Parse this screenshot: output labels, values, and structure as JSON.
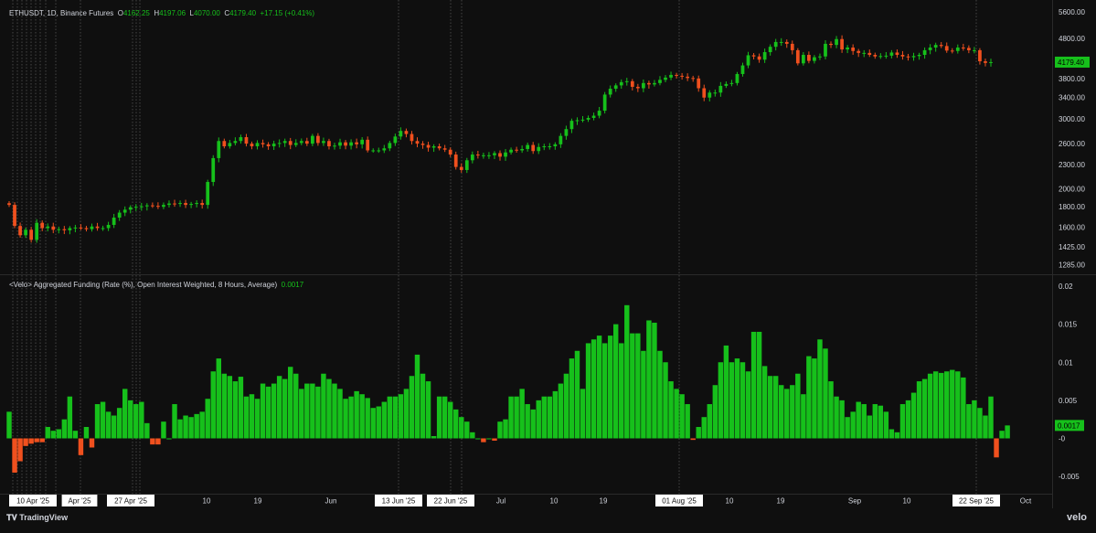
{
  "header": {
    "symbol_line": "ETHUSDT, 1D, Binance Futures",
    "o_key": "O",
    "o_val": "4162.25",
    "h_key": "H",
    "h_val": "4197.06",
    "l_key": "L",
    "l_val": "4070.00",
    "c_key": "C",
    "c_val": "4179.40",
    "chg": "+17.15 (+0.41%)"
  },
  "indicator": {
    "title": "<Velo> Aggregated Funding (Rate (%), Open Interest Weighted, 8 Hours, Average)",
    "value": "0.0017"
  },
  "branding": {
    "tradingview": "TradingView",
    "velo": "velo"
  },
  "colors": {
    "up": "#16c01b",
    "down": "#f0501e",
    "bg": "#0f0f0f",
    "grid": "#2a2a2a",
    "text": "#d1d4dc"
  },
  "chart_data": [
    {
      "type": "candlestick",
      "y_axis_scale": "log",
      "price_ticks": [
        "5600.00",
        "4800.00",
        "4200.00",
        "3800.00",
        "3400.00",
        "3000.00",
        "2600.00",
        "2300.00",
        "2000.00",
        "1800.00",
        "1600.00",
        "1425.00",
        "1285.00"
      ],
      "last_price_label": "4179.40",
      "closes": [
        1820,
        1610,
        1525,
        1575,
        1485,
        1640,
        1590,
        1605,
        1575,
        1580,
        1570,
        1590,
        1595,
        1590,
        1580,
        1605,
        1590,
        1590,
        1620,
        1690,
        1740,
        1770,
        1795,
        1800,
        1805,
        1815,
        1810,
        1800,
        1820,
        1835,
        1830,
        1840,
        1820,
        1830,
        1840,
        1820,
        2080,
        2390,
        2640,
        2560,
        2610,
        2640,
        2700,
        2600,
        2560,
        2610,
        2590,
        2560,
        2600,
        2610,
        2640,
        2580,
        2610,
        2640,
        2600,
        2720,
        2610,
        2640,
        2560,
        2570,
        2620,
        2570,
        2620,
        2590,
        2660,
        2500,
        2500,
        2500,
        2530,
        2610,
        2710,
        2800,
        2750,
        2640,
        2600,
        2580,
        2540,
        2560,
        2530,
        2510,
        2440,
        2270,
        2230,
        2360,
        2440,
        2430,
        2430,
        2430,
        2460,
        2410,
        2470,
        2510,
        2500,
        2520,
        2580,
        2490,
        2550,
        2560,
        2560,
        2590,
        2720,
        2830,
        2970,
        2980,
        2990,
        3020,
        3060,
        3150,
        3460,
        3580,
        3650,
        3720,
        3740,
        3620,
        3590,
        3700,
        3670,
        3700,
        3770,
        3820,
        3880,
        3860,
        3840,
        3810,
        3800,
        3590,
        3400,
        3500,
        3500,
        3640,
        3680,
        3700,
        3900,
        4100,
        4350,
        4320,
        4240,
        4430,
        4570,
        4700,
        4700,
        4650,
        4480,
        4150,
        4360,
        4210,
        4300,
        4320,
        4650,
        4620,
        4780,
        4500,
        4550,
        4460,
        4410,
        4410,
        4360,
        4320,
        4330,
        4340,
        4420,
        4360,
        4320,
        4300,
        4330,
        4360,
        4480,
        4550,
        4620,
        4590,
        4470,
        4460,
        4550,
        4540,
        4480,
        4480,
        4200,
        4160,
        4180
      ],
      "funding_values": [
        0.0035,
        -0.0045,
        -0.003,
        -0.001,
        -0.0007,
        -0.0005,
        -0.0005,
        0.0015,
        0.001,
        0.0012,
        0.0025,
        0.0055,
        0.001,
        -0.0022,
        0.0015,
        -0.0012,
        0.0045,
        0.0048,
        0.0035,
        0.003,
        0.004,
        0.0065,
        0.005,
        0.0045,
        0.0048,
        0.002,
        -0.0008,
        -0.0008,
        0.0022,
        0.0,
        0.0045,
        0.0025,
        0.003,
        0.0028,
        0.0032,
        0.0035,
        0.0052,
        0.0088,
        0.0105,
        0.0085,
        0.0082,
        0.0075,
        0.0081,
        0.0055,
        0.0058,
        0.0052,
        0.0072,
        0.0068,
        0.0072,
        0.0082,
        0.0078,
        0.0094,
        0.0085,
        0.0065,
        0.0072,
        0.0072,
        0.0068,
        0.0085,
        0.0078,
        0.0072,
        0.0065,
        0.0052,
        0.0055,
        0.0062,
        0.0058,
        0.0053,
        0.004,
        0.0042,
        0.0048,
        0.0055,
        0.0055,
        0.0058,
        0.0065,
        0.0082,
        0.011,
        0.0085,
        0.0075,
        0.0003,
        0.0055,
        0.0055,
        0.0048,
        0.0038,
        0.0028,
        0.0022,
        0.0008,
        0.0,
        -0.0005,
        0.0,
        -0.0003,
        0.0022,
        0.0025,
        0.0055,
        0.0055,
        0.0065,
        0.0045,
        0.0038,
        0.005,
        0.0055,
        0.0055,
        0.0062,
        0.0072,
        0.0085,
        0.0105,
        0.0115,
        0.0065,
        0.0125,
        0.013,
        0.0135,
        0.0125,
        0.0135,
        0.015,
        0.0125,
        0.0175,
        0.0138,
        0.0138,
        0.0115,
        0.0155,
        0.0152,
        0.0115,
        0.01,
        0.0075,
        0.0065,
        0.0058,
        0.0045,
        -0.0002,
        0.0015,
        0.0028,
        0.0045,
        0.007,
        0.01,
        0.0122,
        0.01,
        0.0105,
        0.01,
        0.0088,
        0.014,
        0.014,
        0.0095,
        0.0082,
        0.0082,
        0.007,
        0.0065,
        0.007,
        0.0085,
        0.0058,
        0.0108,
        0.0105,
        0.013,
        0.0118,
        0.0075,
        0.0055,
        0.005,
        0.0028,
        0.0035,
        0.0048,
        0.0045,
        0.003,
        0.0045,
        0.0043,
        0.0035,
        0.0012,
        0.0008,
        0.0045,
        0.005,
        0.006,
        0.0075,
        0.0078,
        0.0085,
        0.0088,
        0.0086,
        0.0088,
        0.009,
        0.0088,
        0.008,
        0.0045,
        0.005,
        0.004,
        0.003,
        0.0055,
        -0.0025,
        0.001,
        0.0017
      ],
      "funding_ticks": [
        "0.02",
        "0.015",
        "0.01",
        "0.005",
        "-0",
        "-0.005"
      ],
      "funding_last_label": "0.0017",
      "x_tick_labels": [
        "10 Apr '25",
        "Apr '25",
        "27 Apr '25",
        "10",
        "19",
        "Jun",
        "13 Jun '25",
        "22 Jun '25",
        "Jul",
        "10",
        "19",
        "01 Aug '25",
        "10",
        "19",
        "Sep",
        "10",
        "22 Sep '25",
        "Oct"
      ]
    }
  ]
}
